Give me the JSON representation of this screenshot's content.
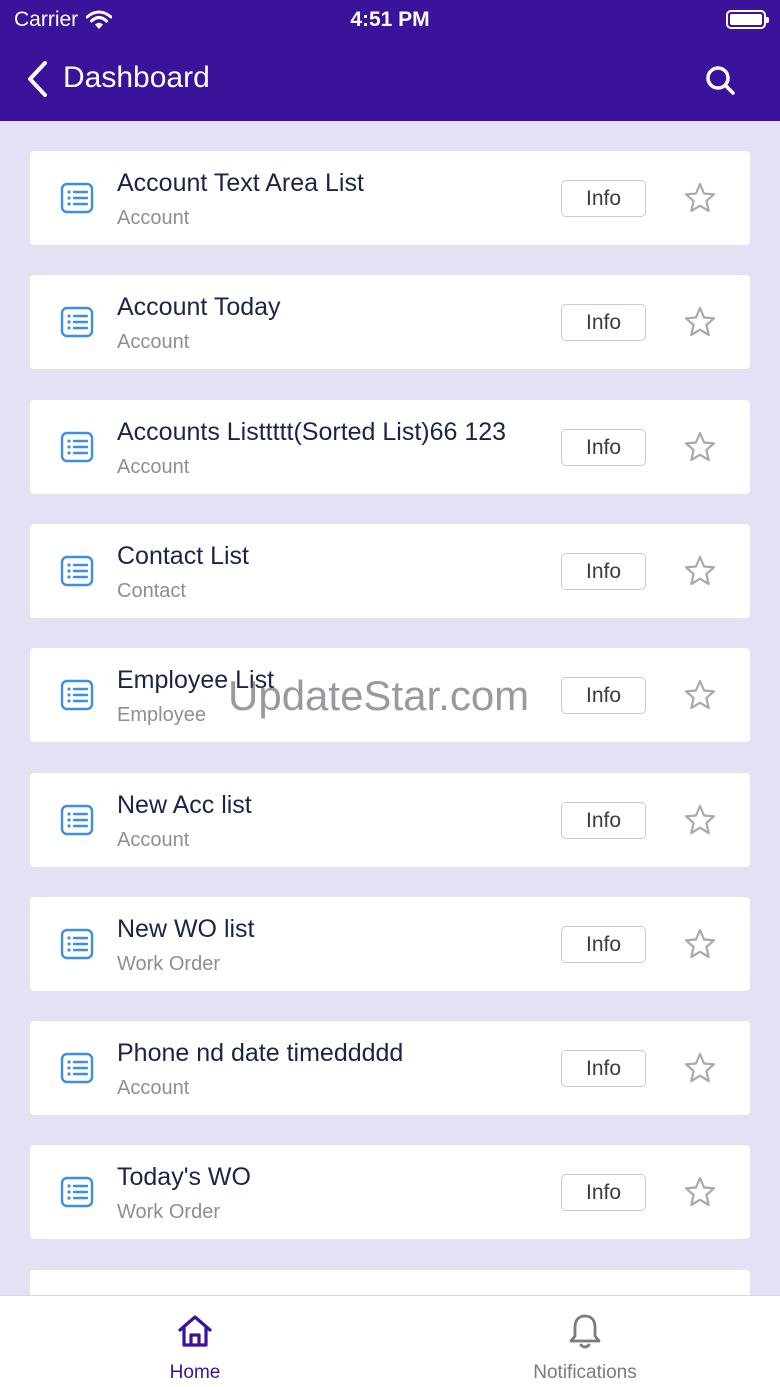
{
  "status_bar": {
    "carrier": "Carrier",
    "time": "4:51 PM"
  },
  "nav": {
    "title": "Dashboard"
  },
  "items": [
    {
      "title": "Account Text Area List",
      "subtitle": "Account",
      "info_label": "Info"
    },
    {
      "title": "Account Today",
      "subtitle": "Account",
      "info_label": "Info"
    },
    {
      "title": "Accounts Listtttt(Sorted List)66 123",
      "subtitle": "Account",
      "info_label": "Info"
    },
    {
      "title": "Contact List",
      "subtitle": "Contact",
      "info_label": "Info"
    },
    {
      "title": "Employee List",
      "subtitle": "Employee",
      "info_label": "Info"
    },
    {
      "title": "New Acc list",
      "subtitle": "Account",
      "info_label": "Info"
    },
    {
      "title": "New WO list",
      "subtitle": "Work Order",
      "info_label": "Info"
    },
    {
      "title": "Phone nd date timeddddd",
      "subtitle": "Account",
      "info_label": "Info"
    },
    {
      "title": "Today's WO",
      "subtitle": "Work Order",
      "info_label": "Info"
    }
  ],
  "watermark": "UpdateStar.com",
  "tabs": [
    {
      "label": "Home",
      "icon": "home-icon",
      "active": true
    },
    {
      "label": "Notifications",
      "icon": "bell-icon",
      "active": false
    }
  ],
  "colors": {
    "header": "#3a139a",
    "background": "#e6e0f4",
    "icon_blue": "#3d8ee8",
    "title_text": "#1b2447",
    "active_tab": "#3a139a"
  }
}
